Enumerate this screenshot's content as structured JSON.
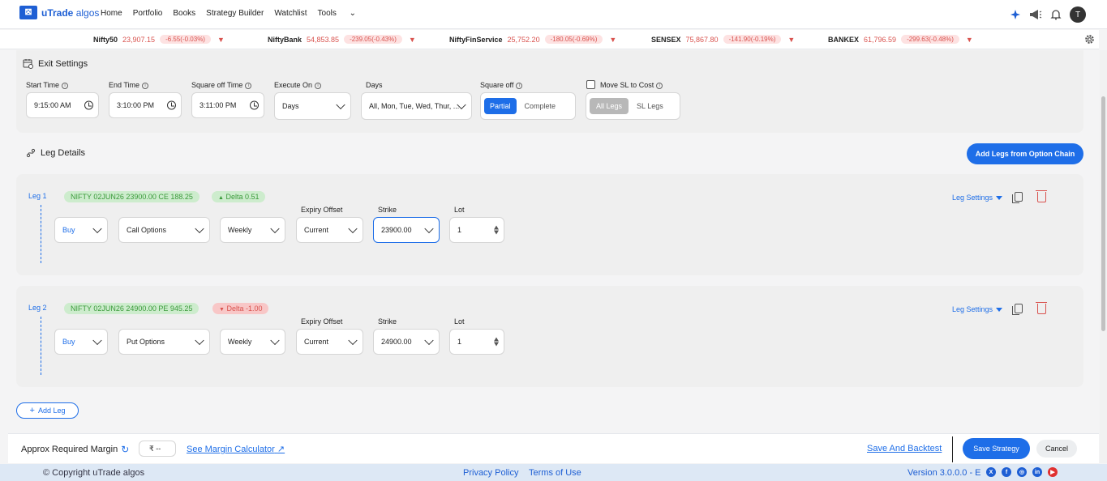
{
  "app": {
    "logo_text_bold": "uTrade",
    "logo_text": " algos"
  },
  "nav": {
    "items": [
      "Home",
      "Portfolio",
      "Books",
      "Strategy Builder",
      "Watchlist",
      "Tools"
    ],
    "avatar": "T"
  },
  "ticker": [
    {
      "name": "Nifty50",
      "value": "23,907.15",
      "change": "-6.55(-0.03%)"
    },
    {
      "name": "NiftyBank",
      "value": "54,853.85",
      "change": "-239.05(-0.43%)"
    },
    {
      "name": "NiftyFinService",
      "value": "25,752.20",
      "change": "-180.05(-0.69%)"
    },
    {
      "name": "SENSEX",
      "value": "75,867.80",
      "change": "-141.90(-0.19%)"
    },
    {
      "name": "BANKEX",
      "value": "61,796.59",
      "change": "-299.63(-0.48%)"
    }
  ],
  "exit": {
    "title": "Exit Settings",
    "start_label": "Start Time",
    "start_value": "9:15:00 AM",
    "end_label": "End Time",
    "end_value": "3:10:00 PM",
    "sq_time_label": "Square off Time",
    "sq_time_value": "3:11:00 PM",
    "exec_label": "Execute On",
    "exec_value": "Days",
    "days_label": "Days",
    "days_value": "All, Mon, Tue, Wed, Thur, ...",
    "sq_label": "Square off",
    "sq_partial": "Partial",
    "sq_complete": "Complete",
    "sl_label": "Move SL to Cost",
    "sl_all": "All Legs",
    "sl_sl": "SL Legs"
  },
  "legs_section": {
    "title": "Leg Details",
    "add_chain": "Add Legs from Option Chain",
    "add_leg": "Add Leg"
  },
  "legs": [
    {
      "name": "Leg 1",
      "instrument": "NIFTY 02JUN26 23900.00 CE 188.25",
      "delta": "Delta 0.51",
      "side": "Buy",
      "type": "Call Options",
      "expiry": "Weekly",
      "offset_label": "Expiry Offset",
      "offset": "Current",
      "strike_label": "Strike",
      "strike": "23900.00",
      "lot_label": "Lot",
      "lot": "1",
      "settings": "Leg Settings"
    },
    {
      "name": "Leg 2",
      "instrument": "NIFTY 02JUN26 24900.00 PE 945.25",
      "delta": "Delta -1.00",
      "side": "Buy",
      "type": "Put Options",
      "expiry": "Weekly",
      "offset_label": "Expiry Offset",
      "offset": "Current",
      "strike_label": "Strike",
      "strike": "24900.00",
      "lot_label": "Lot",
      "lot": "1",
      "settings": "Leg Settings"
    }
  ],
  "footer": {
    "margin_label": "Approx Required Margin",
    "margin_value": "₹ --",
    "calc_link": "See Margin Calculator",
    "save_backtest": "Save And Backtest",
    "save": "Save Strategy",
    "cancel": "Cancel"
  },
  "bottom": {
    "copyright": "© Copyright uTrade algos",
    "privacy": "Privacy Policy",
    "terms": "Terms of Use",
    "version": "Version 3.0.0.0 - E"
  }
}
